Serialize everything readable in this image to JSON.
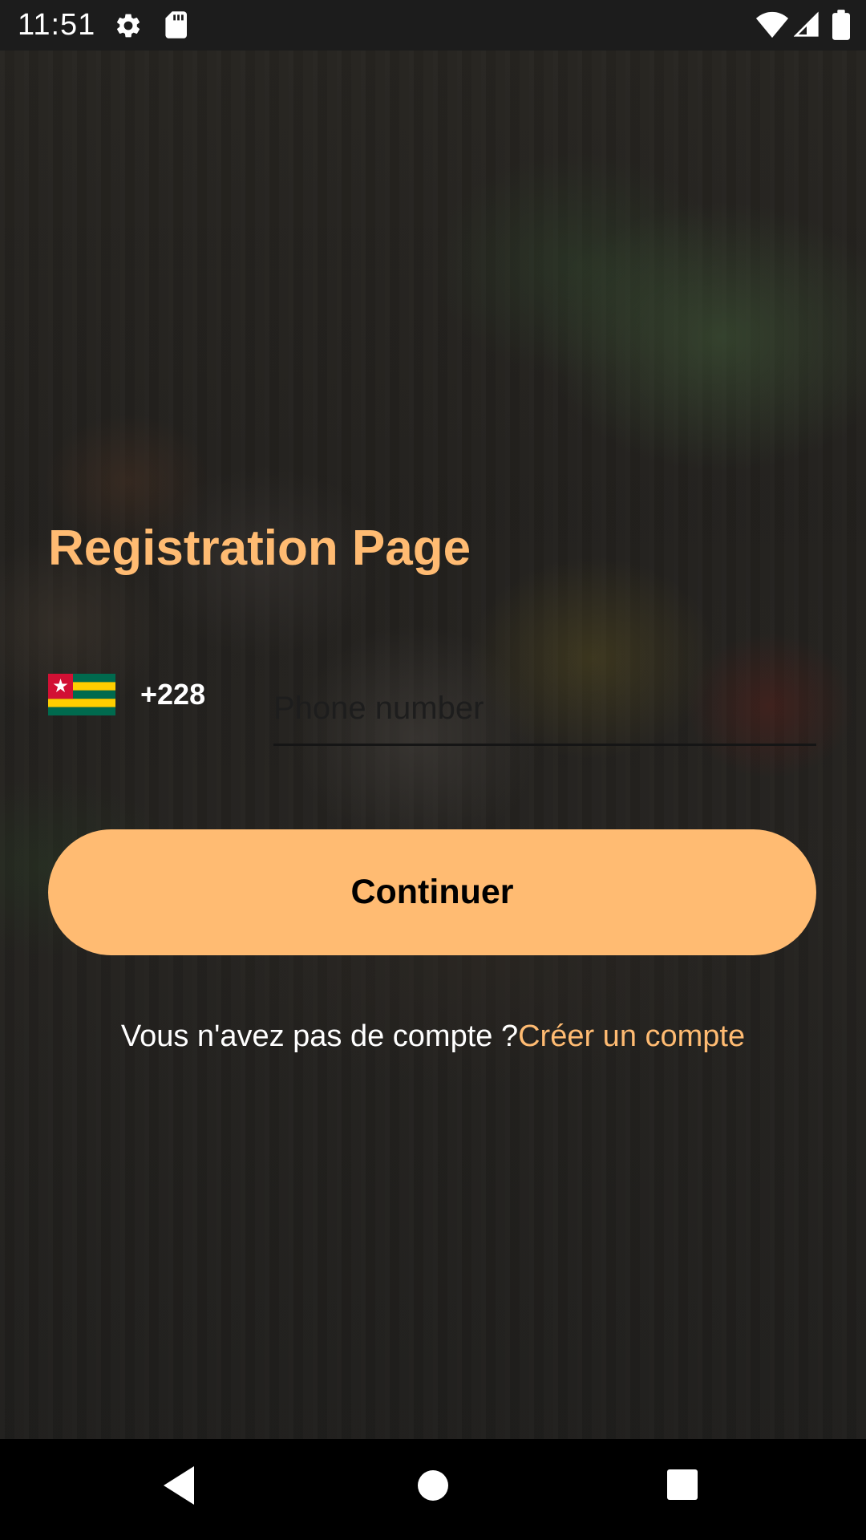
{
  "status_bar": {
    "time": "11:51",
    "icons": [
      "settings-icon",
      "sd-card-icon",
      "wifi-icon",
      "signal-icon",
      "battery-icon"
    ]
  },
  "page": {
    "title": "Registration Page"
  },
  "phone": {
    "country_flag": "togo-flag",
    "country_code": "+228",
    "placeholder": "Phone number",
    "value": ""
  },
  "continue_button": {
    "label": "Continuer"
  },
  "signup": {
    "prompt": "Vous n'avez pas de compte ?",
    "link": "Créer un compte"
  },
  "nav_bar": {
    "icons": [
      "back-icon",
      "home-icon",
      "recents-icon"
    ]
  },
  "colors": {
    "accent": "#ffbb72",
    "status_bar": "#1c1c1c",
    "nav_bar": "#000000",
    "text_light": "#ffffff"
  }
}
